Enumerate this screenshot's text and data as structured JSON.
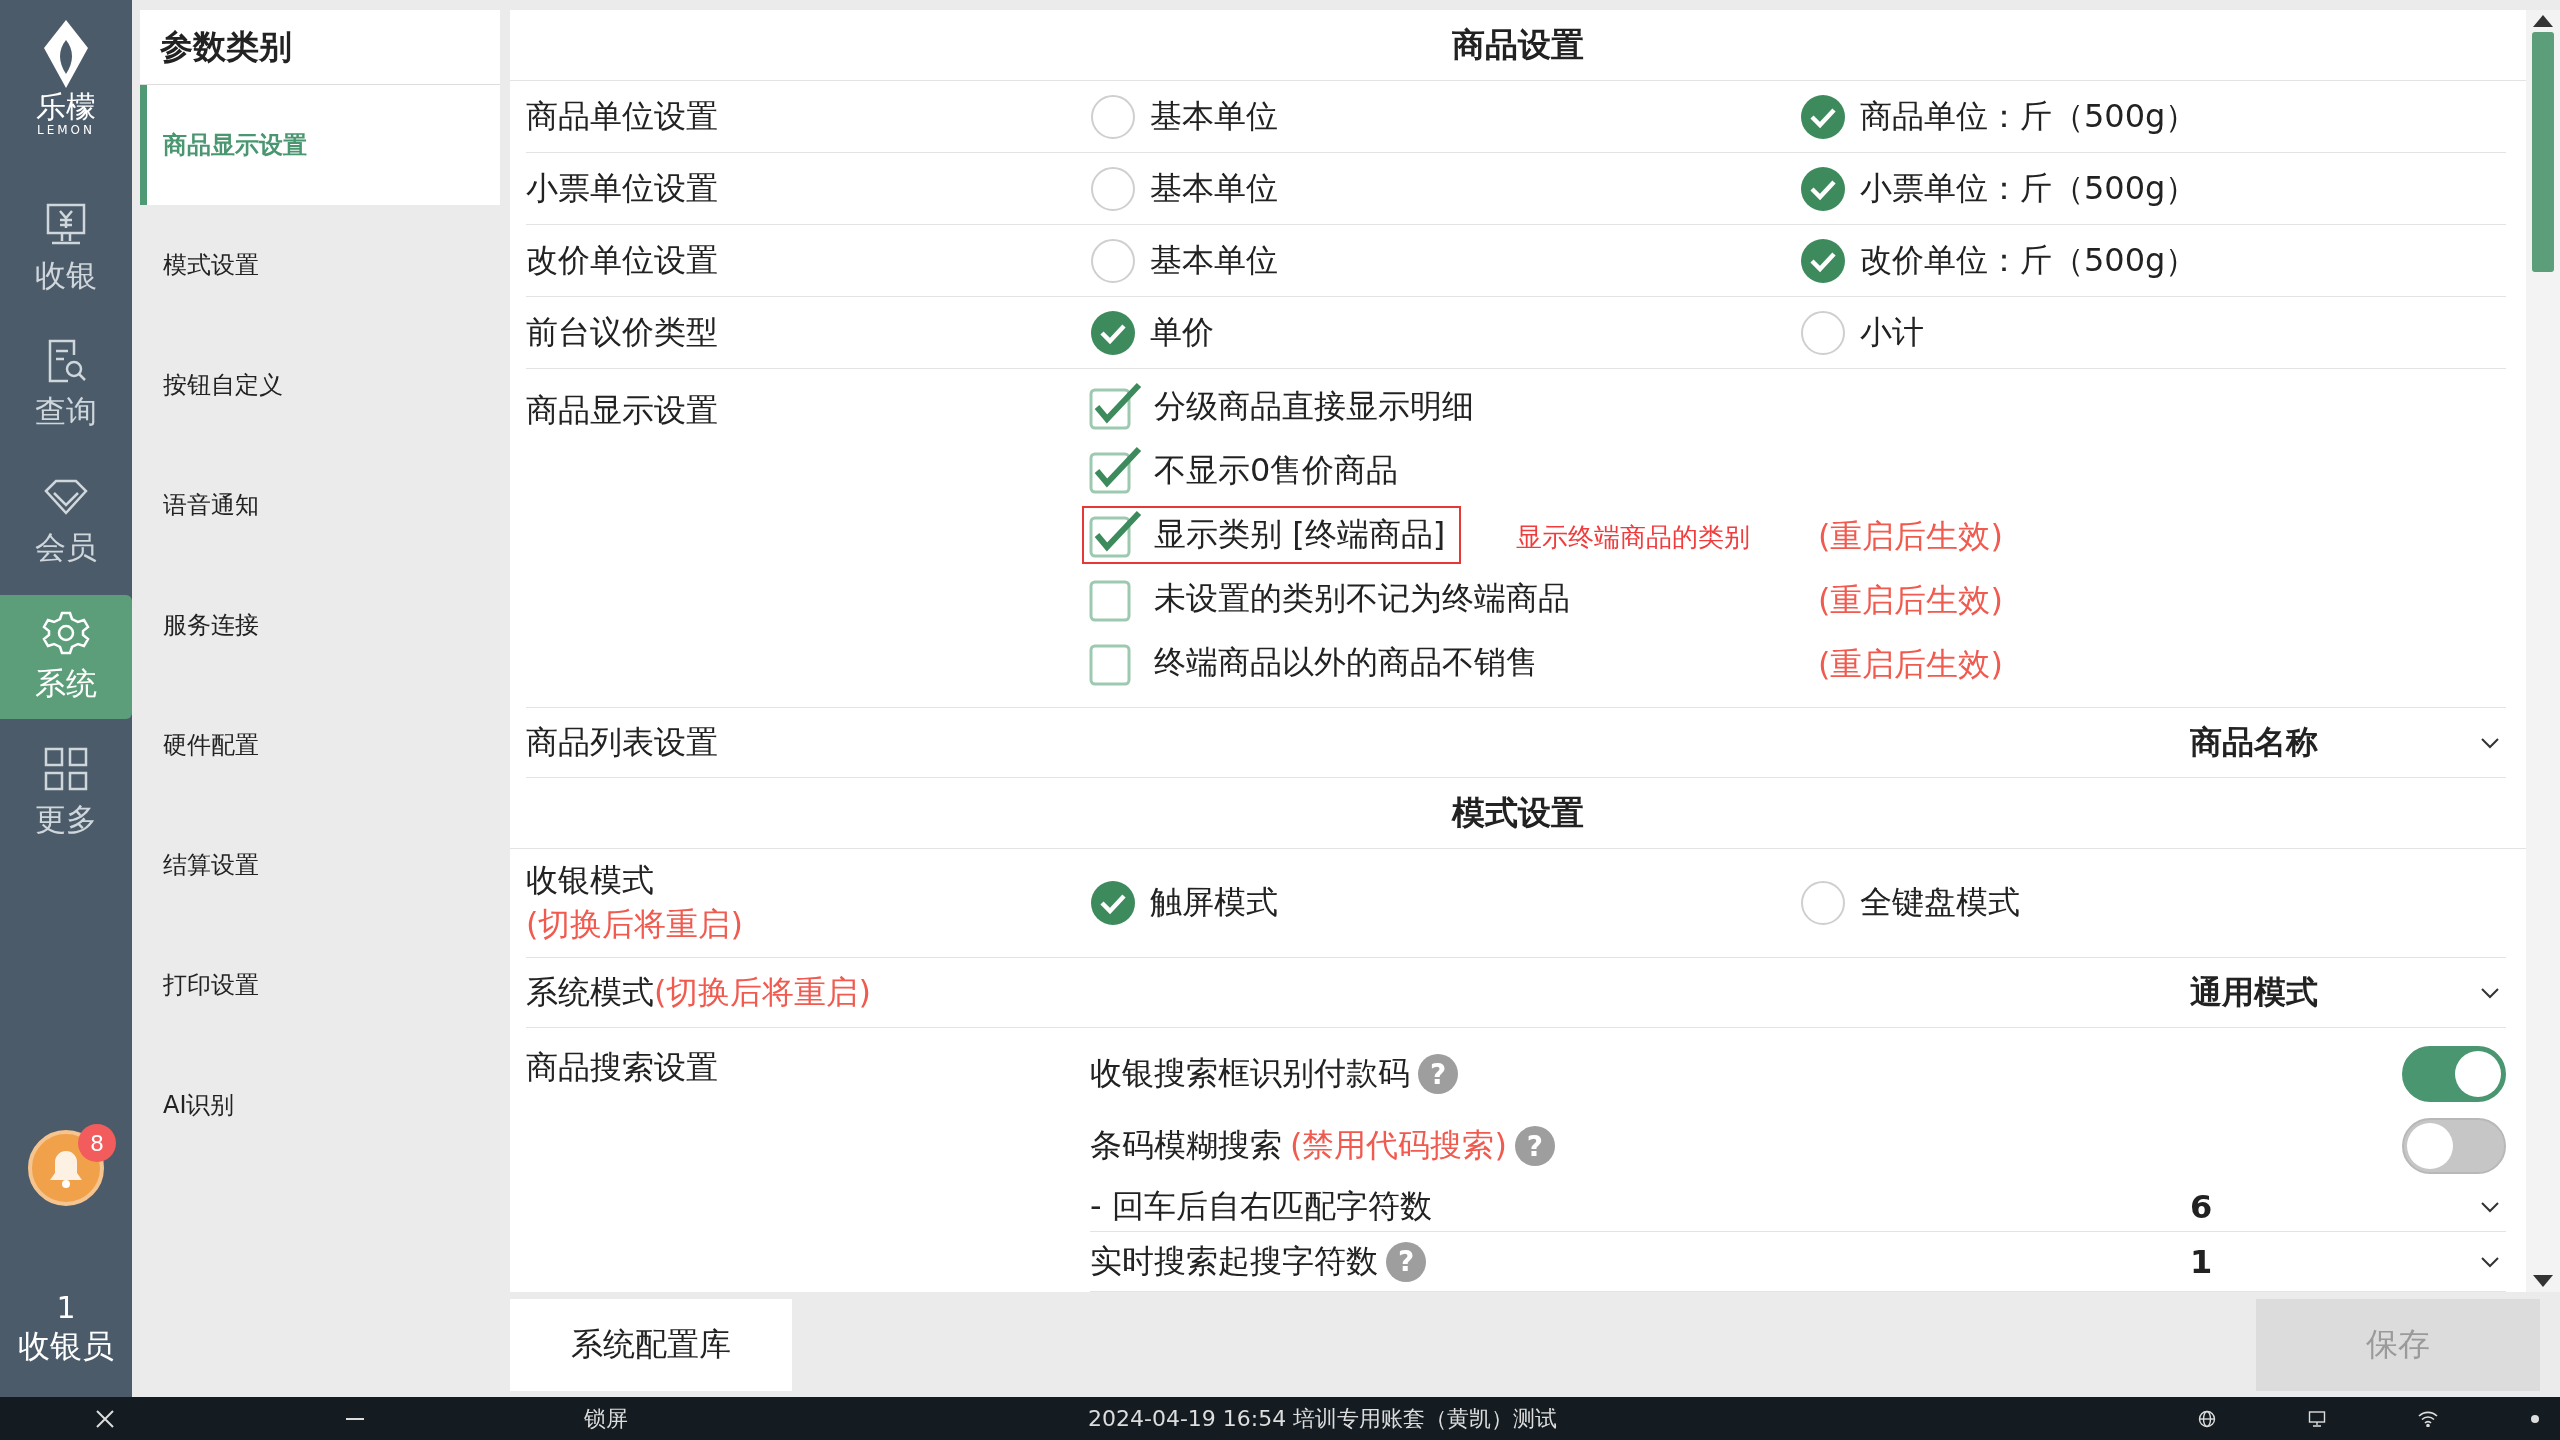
{
  "logo": {
    "name": "乐檬",
    "sub": "LEMON"
  },
  "nav": [
    {
      "label": "收银",
      "selected": false
    },
    {
      "label": "查询",
      "selected": false
    },
    {
      "label": "会员",
      "selected": false
    },
    {
      "label": "系统",
      "selected": true
    },
    {
      "label": "更多",
      "selected": false
    }
  ],
  "notification": {
    "badge": "8"
  },
  "user": {
    "count": "1",
    "role": "收银员"
  },
  "categories": {
    "title": "参数类别",
    "items": [
      {
        "label": "商品显示设置",
        "selected": true
      },
      {
        "label": "模式设置",
        "selected": false
      },
      {
        "label": "按钮自定义",
        "selected": false
      },
      {
        "label": "语音通知",
        "selected": false
      },
      {
        "label": "服务连接",
        "selected": false
      },
      {
        "label": "硬件配置",
        "selected": false
      },
      {
        "label": "结算设置",
        "selected": false
      },
      {
        "label": "打印设置",
        "selected": false
      },
      {
        "label": "AI识别",
        "selected": false
      }
    ]
  },
  "sections": [
    {
      "title": "商品设置",
      "rows": [
        {
          "kind": "radio",
          "label": "商品单位设置",
          "options": [
            {
              "label": "基本单位",
              "selected": false
            },
            {
              "label": "商品单位：斤（500g）",
              "selected": true
            }
          ]
        },
        {
          "kind": "radio",
          "label": "小票单位设置",
          "options": [
            {
              "label": "基本单位",
              "selected": false
            },
            {
              "label": "小票单位：斤（500g）",
              "selected": true
            }
          ]
        },
        {
          "kind": "radio",
          "label": "改价单位设置",
          "options": [
            {
              "label": "基本单位",
              "selected": false
            },
            {
              "label": "改价单位：斤（500g）",
              "selected": true
            }
          ]
        },
        {
          "kind": "radio",
          "label": "前台议价类型",
          "options": [
            {
              "label": "单价",
              "selected": true
            },
            {
              "label": "小计",
              "selected": false
            }
          ]
        },
        {
          "kind": "checklist",
          "label": "商品显示设置",
          "items": [
            {
              "label": "分级商品直接显示明细",
              "checked": true,
              "highlighted": false
            },
            {
              "label": "不显示0售价商品",
              "checked": true,
              "highlighted": false
            },
            {
              "label": "显示类别 [终端商品]",
              "checked": true,
              "highlighted": true,
              "hint": "显示终端商品的类别",
              "note": "(重启后生效)"
            },
            {
              "label": "未设置的类别不记为终端商品",
              "checked": false,
              "highlighted": false,
              "note": "(重启后生效)"
            },
            {
              "label": "终端商品以外的商品不销售",
              "checked": false,
              "highlighted": false,
              "note": "(重启后生效)"
            }
          ]
        },
        {
          "kind": "select",
          "label": "商品列表设置",
          "value": "商品名称"
        }
      ]
    },
    {
      "title": "模式设置",
      "rows": [
        {
          "kind": "radio",
          "label": "收银模式",
          "label_note": "(切换后将重启)",
          "options": [
            {
              "label": "触屏模式",
              "selected": true
            },
            {
              "label": "全键盘模式",
              "selected": false
            }
          ]
        },
        {
          "kind": "select",
          "label": "系统模式",
          "label_note": "(切换后将重启)",
          "value": "通用模式"
        },
        {
          "kind": "group",
          "label": "商品搜索设置",
          "items": [
            {
              "kind": "switch",
              "label": "收银搜索框识别付款码",
              "help": "?",
              "on": true
            },
            {
              "kind": "switch",
              "label": "条码模糊搜索",
              "label_note": "(禁用代码搜索)",
              "help": "?",
              "on": false
            },
            {
              "kind": "select",
              "label": "- 回车后自右匹配字符数",
              "value": "6"
            },
            {
              "kind": "select",
              "label": "实时搜索起搜字符数",
              "help": "?",
              "value": "1"
            }
          ]
        }
      ]
    }
  ],
  "library_button": "系统配置库",
  "save_button": {
    "label": "保存",
    "disabled": true
  },
  "taskbar": {
    "lock": "锁屏",
    "status": "2024-04-19 16:54 培训专用账套（黄凯）测试"
  }
}
